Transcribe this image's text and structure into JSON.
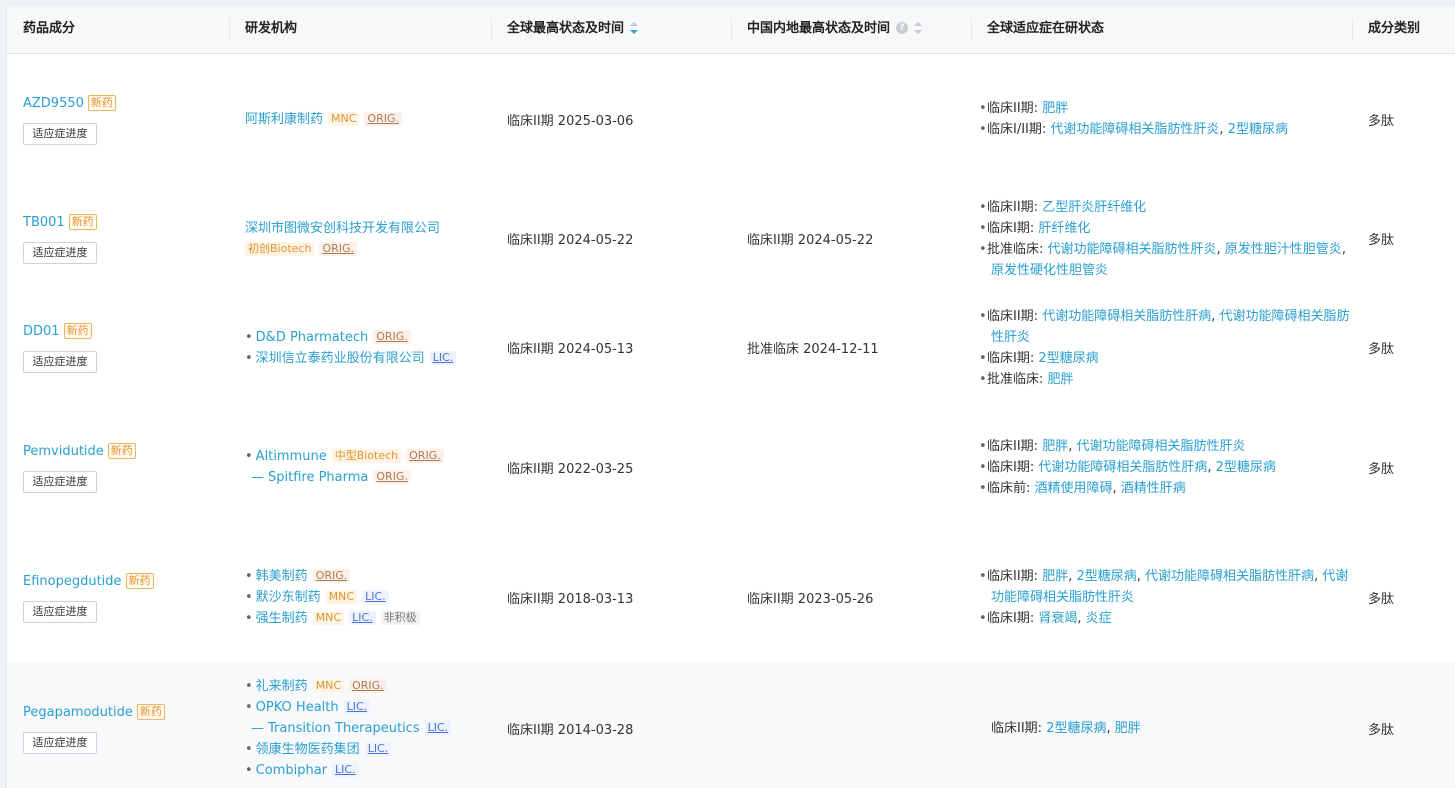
{
  "header": {
    "columns": [
      {
        "label": "药品成分"
      },
      {
        "label": "研发机构"
      },
      {
        "label": "全球最高状态及时间"
      },
      {
        "label": "中国内地最高状态及时间"
      },
      {
        "label": "全球适应症在研状态"
      },
      {
        "label": "成分类别"
      }
    ]
  },
  "rows": [
    {
      "drug": "AZD9550",
      "badge": "新药",
      "progress_label": "适应症进度",
      "global_status": "临床II期 2025-03-06",
      "china_status": "",
      "category": "多肽",
      "orgs": [
        {
          "name": "阿斯利康制药",
          "tags": [
            "MNC",
            "ORIG."
          ]
        }
      ],
      "indications": [
        {
          "phase": "临床II期: ",
          "items": [
            "肥胖"
          ]
        },
        {
          "phase": "临床I/II期: ",
          "items": [
            "代谢功能障碍相关脂肪性肝炎",
            "2型糖尿病"
          ]
        }
      ]
    },
    {
      "drug": "TB001",
      "badge": "新药",
      "progress_label": "适应症进度",
      "global_status": "临床II期 2024-05-22",
      "china_status": "临床II期 2024-05-22",
      "category": "多肽",
      "orgs": [
        {
          "name": "深圳市图微安创科技开发有限公司",
          "tags": [
            "初创Biotech",
            "ORIG."
          ]
        }
      ],
      "indications": [
        {
          "phase": "临床II期: ",
          "items": [
            "乙型肝炎肝纤维化"
          ]
        },
        {
          "phase": "临床I期: ",
          "items": [
            "肝纤维化"
          ]
        },
        {
          "phase": "批准临床: ",
          "items": [
            "代谢功能障碍相关脂肪性肝炎",
            "原发性胆汁性胆管炎",
            "原发性硬化性胆管炎"
          ]
        }
      ]
    },
    {
      "drug": "DD01",
      "badge": "新药",
      "progress_label": "适应症进度",
      "global_status": "临床II期 2024-05-13",
      "china_status": "批准临床 2024-12-11",
      "category": "多肽",
      "orgs": [
        {
          "name": "D&D Pharmatech",
          "tags": [
            "ORIG."
          ]
        },
        {
          "name": "深圳信立泰药业股份有限公司",
          "tags": [
            "LIC."
          ]
        }
      ],
      "indications": [
        {
          "phase": "临床II期: ",
          "items": [
            "代谢功能障碍相关脂肪性肝病",
            "代谢功能障碍相关脂肪性肝炎"
          ]
        },
        {
          "phase": "临床I期: ",
          "items": [
            "2型糖尿病"
          ]
        },
        {
          "phase": "批准临床: ",
          "items": [
            "肥胖"
          ]
        }
      ]
    },
    {
      "drug": "Pemvidutide",
      "badge": "新药",
      "progress_label": "适应症进度",
      "global_status": "临床II期 2022-03-25",
      "china_status": "",
      "category": "多肽",
      "orgs": [
        {
          "name": "Altimmune",
          "tags": [
            "中型Biotech",
            "ORIG."
          ]
        },
        {
          "name": "Spitfire Pharma",
          "tags": [
            "ORIG."
          ],
          "sub": true
        }
      ],
      "indications": [
        {
          "phase": "临床II期: ",
          "items": [
            "肥胖",
            "代谢功能障碍相关脂肪性肝炎"
          ]
        },
        {
          "phase": "临床I期: ",
          "items": [
            "代谢功能障碍相关脂肪性肝病",
            "2型糖尿病"
          ]
        },
        {
          "phase": "临床前: ",
          "items": [
            "酒精使用障碍",
            "酒精性肝病"
          ]
        }
      ]
    },
    {
      "drug": "Efinopegdutide",
      "badge": "新药",
      "progress_label": "适应症进度",
      "global_status": "临床II期 2018-03-13",
      "china_status": "临床II期 2023-05-26",
      "category": "多肽",
      "orgs": [
        {
          "name": "韩美制药",
          "tags": [
            "ORIG."
          ]
        },
        {
          "name": "默沙东制药",
          "tags": [
            "MNC",
            "LIC."
          ]
        },
        {
          "name": "强生制药",
          "tags": [
            "MNC",
            "LIC.",
            "非积极"
          ]
        }
      ],
      "indications": [
        {
          "phase": "临床II期: ",
          "items": [
            "肥胖",
            "2型糖尿病",
            "代谢功能障碍相关脂肪性肝病",
            "代谢功能障碍相关脂肪性肝炎"
          ]
        },
        {
          "phase": "临床I期: ",
          "items": [
            "肾衰竭",
            "炎症"
          ]
        }
      ]
    },
    {
      "drug": "Pegapamodutide",
      "badge": "新药",
      "progress_label": "适应症进度",
      "global_status": "临床II期 2014-03-28",
      "china_status": "",
      "category": "多肽",
      "orgs": [
        {
          "name": "礼来制药",
          "tags": [
            "MNC",
            "ORIG."
          ]
        },
        {
          "name": "OPKO Health",
          "tags": [
            "LIC."
          ]
        },
        {
          "name": "Transition Therapeutics",
          "tags": [
            "LIC."
          ],
          "sub": true
        },
        {
          "name": "领康生物医药集团",
          "tags": [
            "LIC."
          ]
        },
        {
          "name": "Combiphar",
          "tags": [
            "LIC."
          ]
        }
      ],
      "indications": [
        {
          "phase": "临床II期: ",
          "items": [
            "2型糖尿病",
            "肥胖"
          ],
          "nodot": true
        }
      ]
    }
  ],
  "colors": {
    "link": "#2a9fd0",
    "new_badge": "#e8932a",
    "orig_tag": "#b07a52",
    "lic_tag": "#4b75d6"
  }
}
